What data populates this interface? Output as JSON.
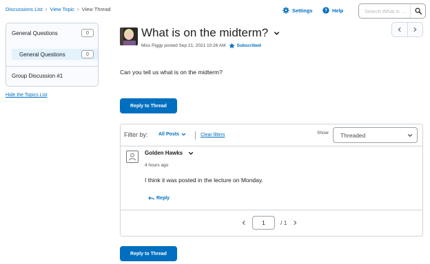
{
  "breadcrumb": {
    "items": [
      "Discussions List",
      "View Topic"
    ],
    "current": "View Thread"
  },
  "header": {
    "settings_label": "Settings",
    "help_label": "Help",
    "search_placeholder": "Search What is ..."
  },
  "sidebar": {
    "items": [
      {
        "label": "General Questions",
        "count": "0"
      },
      {
        "label": "General Questions",
        "count": "0"
      },
      {
        "label": "Group Discussion #1"
      }
    ],
    "hide_link": "Hide the Topics List"
  },
  "thread": {
    "title": "What is on the midterm?",
    "meta": "Miss Piggy posted Sep 21, 2021 10:28 AM",
    "subscribed_label": "Subscribed",
    "body": "Can you tell us what is on the midterm?",
    "reply_button": "Reply to Thread"
  },
  "filters": {
    "filter_by_label": "Filter by:",
    "all_posts_label": "All Posts",
    "clear_label": "Clear filters",
    "show_label": "Show:",
    "show_value": "Threaded"
  },
  "posts": [
    {
      "author": "Golden Hawks",
      "time": "4 hours ago",
      "text": "I think it was posted in the lecture on Monday.",
      "reply_label": "Reply"
    }
  ],
  "pagination": {
    "current": "1",
    "total": "/ 1"
  },
  "colors": {
    "link": "#006fbf",
    "primary_button": "#006fbf",
    "selected_item": "#e3f2fc"
  }
}
